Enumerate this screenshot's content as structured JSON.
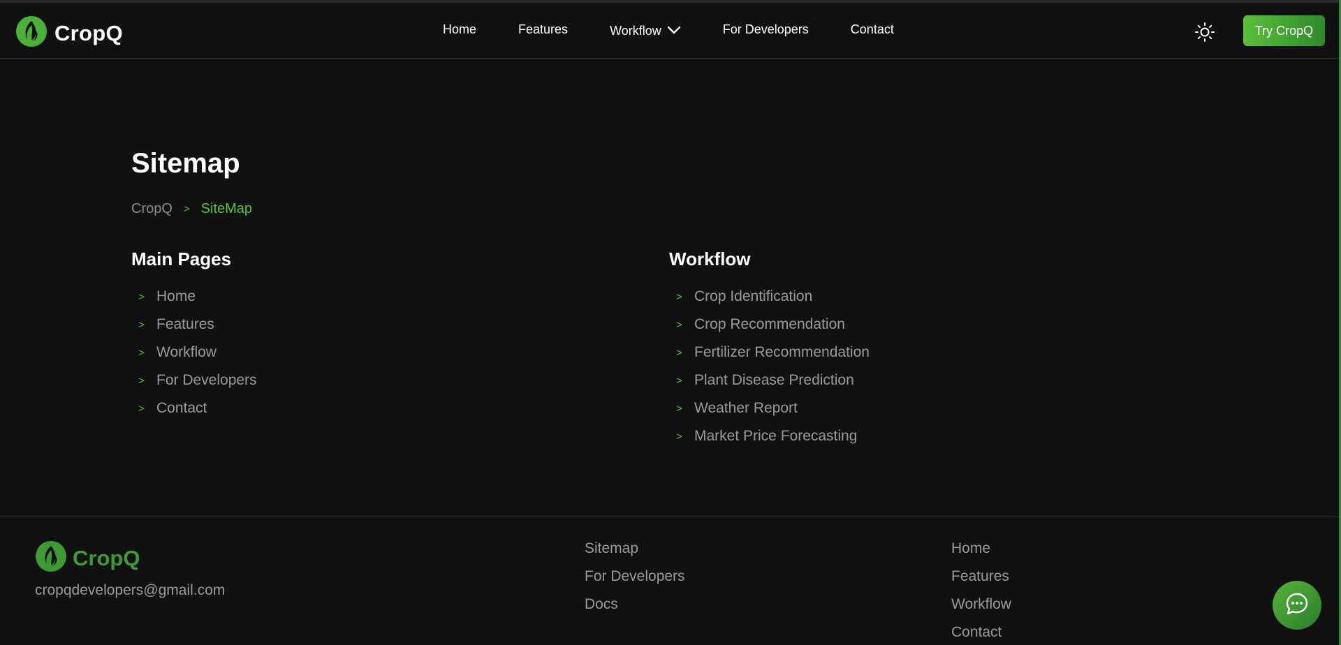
{
  "colors": {
    "background": "#111111",
    "accent": "#5cc23b",
    "muted_text": "#9a9a9a",
    "footer_brand": "#3e9b33"
  },
  "header": {
    "brand": "CropQ",
    "logo_icon": "leaf-flame-icon",
    "nav": [
      {
        "label": "Home"
      },
      {
        "label": "Features"
      },
      {
        "label": "Workflow",
        "icon": "chevron-down-icon"
      },
      {
        "label": "For Developers"
      },
      {
        "label": "Contact"
      }
    ],
    "theme_icon": "sun-icon",
    "cta_label": "Try CropQ"
  },
  "main": {
    "title": "Sitemap",
    "breadcrumb": {
      "root": "CropQ",
      "separator": ">",
      "current": "SiteMap"
    },
    "main_pages": {
      "title": "Main Pages",
      "items": [
        "Home",
        "Features",
        "Workflow",
        "For Developers",
        "Contact"
      ]
    },
    "workflow": {
      "title": "Workflow",
      "items": [
        "Crop Identification",
        "Crop Recommendation",
        "Fertilizer Recommendation",
        "Plant Disease Prediction",
        "Weather Report",
        "Market Price Forecasting"
      ]
    },
    "list_marker": ">"
  },
  "footer": {
    "brand": "CropQ",
    "email": "cropqdevelopers@gmail.com",
    "col1": [
      "Sitemap",
      "For Developers",
      "Docs"
    ],
    "col2": [
      "Home",
      "Features",
      "Workflow",
      "Contact"
    ]
  },
  "chat_icon": "chat-bubble-icon"
}
